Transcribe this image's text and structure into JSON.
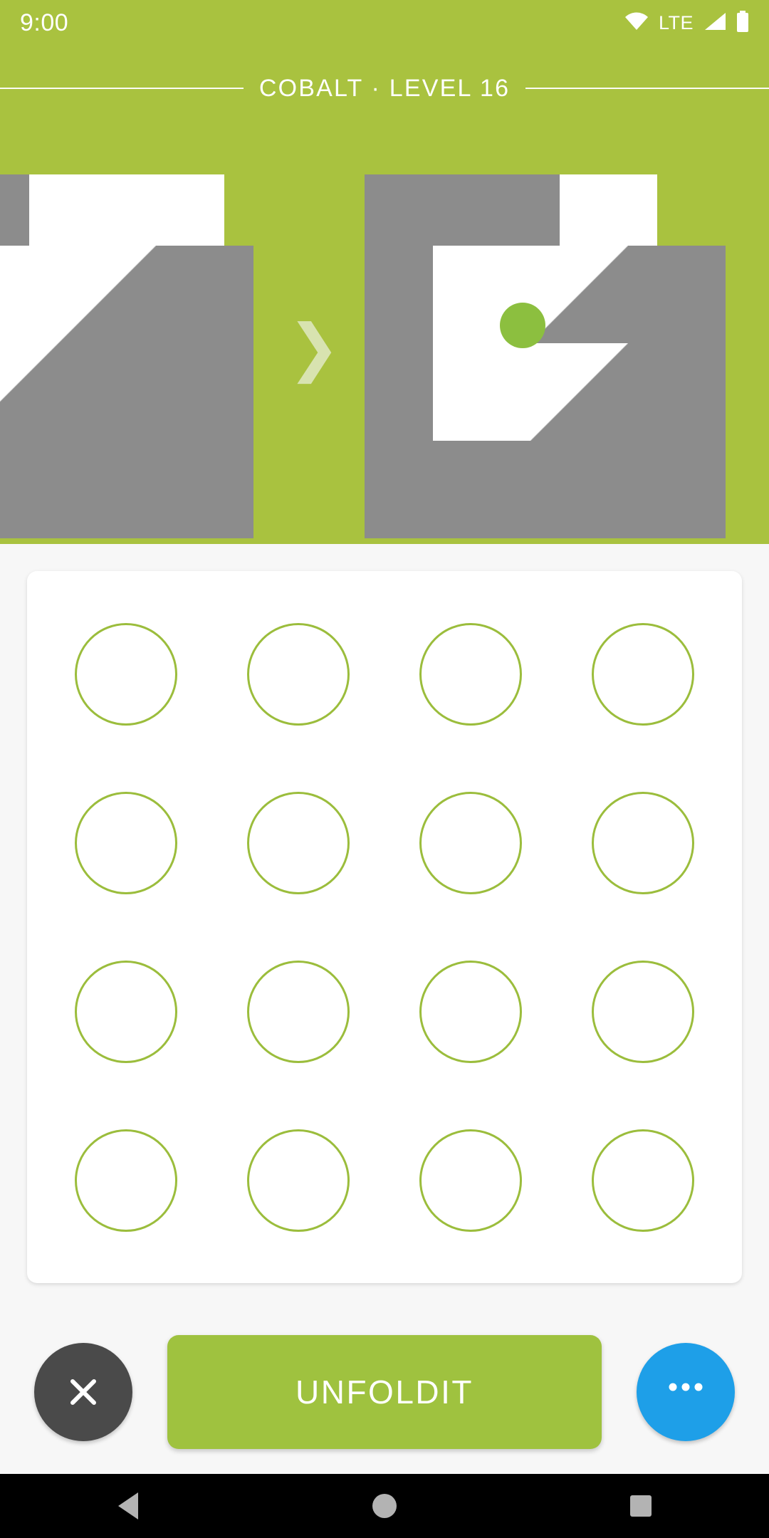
{
  "status_bar": {
    "clock": "9:00",
    "network_label": "LTE",
    "icons": [
      "wifi-icon",
      "lte-label",
      "cellular-signal-icon",
      "battery-icon"
    ]
  },
  "header": {
    "title": "COBALT  ·  LEVEL 16",
    "puzzle_name": "COBALT",
    "level_text": "LEVEL 16",
    "level_number": 16
  },
  "puzzle": {
    "step_arrow": "❯",
    "arrow_icon": "chevron-right-icon",
    "target_dot_color": "#8cbf3f",
    "paper_color": "#ffffff",
    "shadow_color": "#8c8c8c",
    "left_shape_label": "folded-shape-before",
    "right_shape_label": "folded-shape-after"
  },
  "grid": {
    "rows": 4,
    "columns": 4,
    "dot_color": "#9bbd3c",
    "cells": [
      {
        "id": "r1c1",
        "filled": false
      },
      {
        "id": "r1c2",
        "filled": false
      },
      {
        "id": "r1c3",
        "filled": false
      },
      {
        "id": "r1c4",
        "filled": false
      },
      {
        "id": "r2c1",
        "filled": false
      },
      {
        "id": "r2c2",
        "filled": false
      },
      {
        "id": "r2c3",
        "filled": false
      },
      {
        "id": "r2c4",
        "filled": false
      },
      {
        "id": "r3c1",
        "filled": false
      },
      {
        "id": "r3c2",
        "filled": false
      },
      {
        "id": "r3c3",
        "filled": false
      },
      {
        "id": "r3c4",
        "filled": false
      },
      {
        "id": "r4c1",
        "filled": false
      },
      {
        "id": "r4c2",
        "filled": false
      },
      {
        "id": "r4c3",
        "filled": false
      },
      {
        "id": "r4c4",
        "filled": false
      }
    ]
  },
  "actions": {
    "close_label": "✕",
    "primary_label": "UNFOLDIT",
    "more_label": "•••",
    "primary_color": "#9fc23f",
    "close_color": "#4a4a4a",
    "more_color": "#1e9fe8"
  },
  "nav_bar": {
    "back": "back-triangle",
    "home": "home-circle",
    "recents": "recents-square"
  },
  "theme": {
    "accent_green": "#a9c23f",
    "card_background": "#ffffff",
    "page_background": "#f7f7f7"
  }
}
